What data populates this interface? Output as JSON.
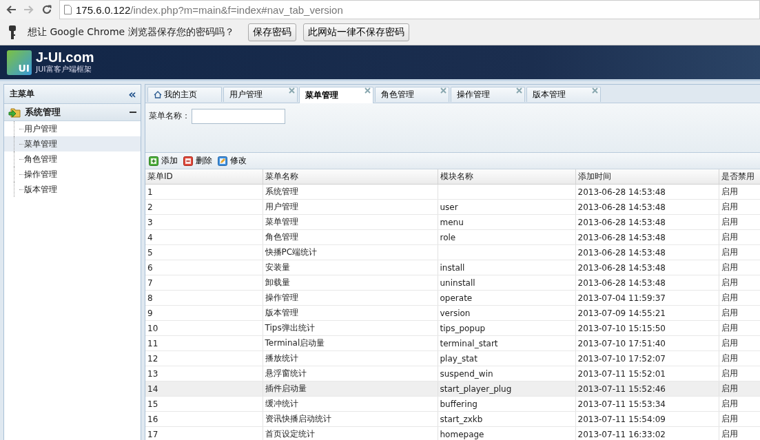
{
  "browser": {
    "url_host": "175.6.0.122",
    "url_path": "/index.php?m=main&f=index#nav_tab_version"
  },
  "infobar": {
    "message": "想让 Google Chrome 浏览器保存您的密码吗？",
    "buttons": [
      "保存密码",
      "此网站一律不保存密码"
    ]
  },
  "header": {
    "logo_mark": "UI",
    "logo_title": "J-UI.com",
    "logo_subtitle": "JUI富客户端框架"
  },
  "sidebar": {
    "title": "主菜单",
    "collapse_glyph": "«",
    "group": {
      "label": "系统管理",
      "expanded": true,
      "items": [
        {
          "label": "用户管理",
          "selected": false
        },
        {
          "label": "菜单管理",
          "selected": true
        },
        {
          "label": "角色管理",
          "selected": false
        },
        {
          "label": "操作管理",
          "selected": false
        },
        {
          "label": "版本管理",
          "selected": false
        }
      ]
    }
  },
  "tabs": [
    {
      "label": "我的主页",
      "selected": false,
      "closable": false
    },
    {
      "label": "用户管理",
      "selected": false,
      "closable": true
    },
    {
      "label": "菜单管理",
      "selected": true,
      "closable": true
    },
    {
      "label": "角色管理",
      "selected": false,
      "closable": true
    },
    {
      "label": "操作管理",
      "selected": false,
      "closable": true
    },
    {
      "label": "版本管理",
      "selected": false,
      "closable": true
    }
  ],
  "search": {
    "label": "菜单名称："
  },
  "toolbar": [
    {
      "kind": "add",
      "label": "添加"
    },
    {
      "kind": "delete",
      "label": "删除"
    },
    {
      "kind": "edit",
      "label": "修改"
    }
  ],
  "table": {
    "columns": [
      "菜单ID",
      "菜单名称",
      "模块名称",
      "添加时间",
      "是否禁用"
    ],
    "rows": [
      {
        "cells": [
          "1",
          "系统管理",
          "",
          "2013-06-28 14:53:48",
          "启用"
        ],
        "selected": false
      },
      {
        "cells": [
          "2",
          "用户管理",
          "user",
          "2013-06-28 14:53:48",
          "启用"
        ],
        "selected": false
      },
      {
        "cells": [
          "3",
          "菜单管理",
          "menu",
          "2013-06-28 14:53:48",
          "启用"
        ],
        "selected": false
      },
      {
        "cells": [
          "4",
          "角色管理",
          "role",
          "2013-06-28 14:53:48",
          "启用"
        ],
        "selected": false
      },
      {
        "cells": [
          "5",
          "快播PC端统计",
          "",
          "2013-06-28 14:53:48",
          "启用"
        ],
        "selected": false
      },
      {
        "cells": [
          "6",
          "安装量",
          "install",
          "2013-06-28 14:53:48",
          "启用"
        ],
        "selected": false
      },
      {
        "cells": [
          "7",
          "卸载量",
          "uninstall",
          "2013-06-28 14:53:48",
          "启用"
        ],
        "selected": false
      },
      {
        "cells": [
          "8",
          "操作管理",
          "operate",
          "2013-07-04 11:59:37",
          "启用"
        ],
        "selected": false
      },
      {
        "cells": [
          "9",
          "版本管理",
          "version",
          "2013-07-09 14:55:21",
          "启用"
        ],
        "selected": false
      },
      {
        "cells": [
          "10",
          "Tips弹出统计",
          "tips_popup",
          "2013-07-10 15:15:50",
          "启用"
        ],
        "selected": false
      },
      {
        "cells": [
          "11",
          "Terminal启动量",
          "terminal_start",
          "2013-07-10 17:51:40",
          "启用"
        ],
        "selected": false
      },
      {
        "cells": [
          "12",
          "播放统计",
          "play_stat",
          "2013-07-10 17:52:07",
          "启用"
        ],
        "selected": false
      },
      {
        "cells": [
          "13",
          "悬浮窗统计",
          "suspend_win",
          "2013-07-11 15:52:01",
          "启用"
        ],
        "selected": false
      },
      {
        "cells": [
          "14",
          "插件启动量",
          "start_player_plug",
          "2013-07-11 15:52:46",
          "启用"
        ],
        "selected": true
      },
      {
        "cells": [
          "15",
          "缓冲统计",
          "buffering",
          "2013-07-11 15:53:34",
          "启用"
        ],
        "selected": false
      },
      {
        "cells": [
          "16",
          "资讯快播启动统计",
          "start_zxkb",
          "2013-07-11 15:54:09",
          "启用"
        ],
        "selected": false
      },
      {
        "cells": [
          "17",
          "首页设定统计",
          "homepage",
          "2013-07-11 16:33:02",
          "启用"
        ],
        "selected": false
      }
    ]
  }
}
